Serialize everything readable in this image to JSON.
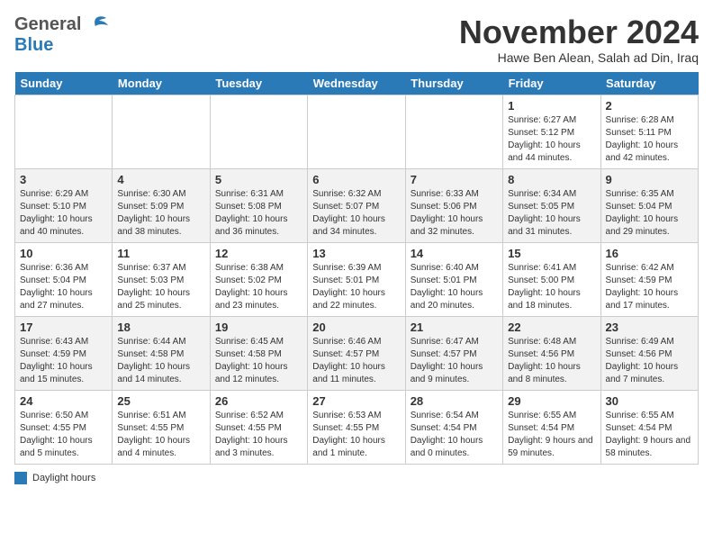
{
  "header": {
    "logo_general": "General",
    "logo_blue": "Blue",
    "month": "November 2024",
    "location": "Hawe Ben Alean, Salah ad Din, Iraq"
  },
  "weekdays": [
    "Sunday",
    "Monday",
    "Tuesday",
    "Wednesday",
    "Thursday",
    "Friday",
    "Saturday"
  ],
  "legend": {
    "label": "Daylight hours"
  },
  "weeks": [
    [
      {
        "day": "",
        "sunrise": "",
        "sunset": "",
        "daylight": ""
      },
      {
        "day": "",
        "sunrise": "",
        "sunset": "",
        "daylight": ""
      },
      {
        "day": "",
        "sunrise": "",
        "sunset": "",
        "daylight": ""
      },
      {
        "day": "",
        "sunrise": "",
        "sunset": "",
        "daylight": ""
      },
      {
        "day": "",
        "sunrise": "",
        "sunset": "",
        "daylight": ""
      },
      {
        "day": "1",
        "sunrise": "Sunrise: 6:27 AM",
        "sunset": "Sunset: 5:12 PM",
        "daylight": "Daylight: 10 hours and 44 minutes."
      },
      {
        "day": "2",
        "sunrise": "Sunrise: 6:28 AM",
        "sunset": "Sunset: 5:11 PM",
        "daylight": "Daylight: 10 hours and 42 minutes."
      }
    ],
    [
      {
        "day": "3",
        "sunrise": "Sunrise: 6:29 AM",
        "sunset": "Sunset: 5:10 PM",
        "daylight": "Daylight: 10 hours and 40 minutes."
      },
      {
        "day": "4",
        "sunrise": "Sunrise: 6:30 AM",
        "sunset": "Sunset: 5:09 PM",
        "daylight": "Daylight: 10 hours and 38 minutes."
      },
      {
        "day": "5",
        "sunrise": "Sunrise: 6:31 AM",
        "sunset": "Sunset: 5:08 PM",
        "daylight": "Daylight: 10 hours and 36 minutes."
      },
      {
        "day": "6",
        "sunrise": "Sunrise: 6:32 AM",
        "sunset": "Sunset: 5:07 PM",
        "daylight": "Daylight: 10 hours and 34 minutes."
      },
      {
        "day": "7",
        "sunrise": "Sunrise: 6:33 AM",
        "sunset": "Sunset: 5:06 PM",
        "daylight": "Daylight: 10 hours and 32 minutes."
      },
      {
        "day": "8",
        "sunrise": "Sunrise: 6:34 AM",
        "sunset": "Sunset: 5:05 PM",
        "daylight": "Daylight: 10 hours and 31 minutes."
      },
      {
        "day": "9",
        "sunrise": "Sunrise: 6:35 AM",
        "sunset": "Sunset: 5:04 PM",
        "daylight": "Daylight: 10 hours and 29 minutes."
      }
    ],
    [
      {
        "day": "10",
        "sunrise": "Sunrise: 6:36 AM",
        "sunset": "Sunset: 5:04 PM",
        "daylight": "Daylight: 10 hours and 27 minutes."
      },
      {
        "day": "11",
        "sunrise": "Sunrise: 6:37 AM",
        "sunset": "Sunset: 5:03 PM",
        "daylight": "Daylight: 10 hours and 25 minutes."
      },
      {
        "day": "12",
        "sunrise": "Sunrise: 6:38 AM",
        "sunset": "Sunset: 5:02 PM",
        "daylight": "Daylight: 10 hours and 23 minutes."
      },
      {
        "day": "13",
        "sunrise": "Sunrise: 6:39 AM",
        "sunset": "Sunset: 5:01 PM",
        "daylight": "Daylight: 10 hours and 22 minutes."
      },
      {
        "day": "14",
        "sunrise": "Sunrise: 6:40 AM",
        "sunset": "Sunset: 5:01 PM",
        "daylight": "Daylight: 10 hours and 20 minutes."
      },
      {
        "day": "15",
        "sunrise": "Sunrise: 6:41 AM",
        "sunset": "Sunset: 5:00 PM",
        "daylight": "Daylight: 10 hours and 18 minutes."
      },
      {
        "day": "16",
        "sunrise": "Sunrise: 6:42 AM",
        "sunset": "Sunset: 4:59 PM",
        "daylight": "Daylight: 10 hours and 17 minutes."
      }
    ],
    [
      {
        "day": "17",
        "sunrise": "Sunrise: 6:43 AM",
        "sunset": "Sunset: 4:59 PM",
        "daylight": "Daylight: 10 hours and 15 minutes."
      },
      {
        "day": "18",
        "sunrise": "Sunrise: 6:44 AM",
        "sunset": "Sunset: 4:58 PM",
        "daylight": "Daylight: 10 hours and 14 minutes."
      },
      {
        "day": "19",
        "sunrise": "Sunrise: 6:45 AM",
        "sunset": "Sunset: 4:58 PM",
        "daylight": "Daylight: 10 hours and 12 minutes."
      },
      {
        "day": "20",
        "sunrise": "Sunrise: 6:46 AM",
        "sunset": "Sunset: 4:57 PM",
        "daylight": "Daylight: 10 hours and 11 minutes."
      },
      {
        "day": "21",
        "sunrise": "Sunrise: 6:47 AM",
        "sunset": "Sunset: 4:57 PM",
        "daylight": "Daylight: 10 hours and 9 minutes."
      },
      {
        "day": "22",
        "sunrise": "Sunrise: 6:48 AM",
        "sunset": "Sunset: 4:56 PM",
        "daylight": "Daylight: 10 hours and 8 minutes."
      },
      {
        "day": "23",
        "sunrise": "Sunrise: 6:49 AM",
        "sunset": "Sunset: 4:56 PM",
        "daylight": "Daylight: 10 hours and 7 minutes."
      }
    ],
    [
      {
        "day": "24",
        "sunrise": "Sunrise: 6:50 AM",
        "sunset": "Sunset: 4:55 PM",
        "daylight": "Daylight: 10 hours and 5 minutes."
      },
      {
        "day": "25",
        "sunrise": "Sunrise: 6:51 AM",
        "sunset": "Sunset: 4:55 PM",
        "daylight": "Daylight: 10 hours and 4 minutes."
      },
      {
        "day": "26",
        "sunrise": "Sunrise: 6:52 AM",
        "sunset": "Sunset: 4:55 PM",
        "daylight": "Daylight: 10 hours and 3 minutes."
      },
      {
        "day": "27",
        "sunrise": "Sunrise: 6:53 AM",
        "sunset": "Sunset: 4:55 PM",
        "daylight": "Daylight: 10 hours and 1 minute."
      },
      {
        "day": "28",
        "sunrise": "Sunrise: 6:54 AM",
        "sunset": "Sunset: 4:54 PM",
        "daylight": "Daylight: 10 hours and 0 minutes."
      },
      {
        "day": "29",
        "sunrise": "Sunrise: 6:55 AM",
        "sunset": "Sunset: 4:54 PM",
        "daylight": "Daylight: 9 hours and 59 minutes."
      },
      {
        "day": "30",
        "sunrise": "Sunrise: 6:55 AM",
        "sunset": "Sunset: 4:54 PM",
        "daylight": "Daylight: 9 hours and 58 minutes."
      }
    ]
  ]
}
